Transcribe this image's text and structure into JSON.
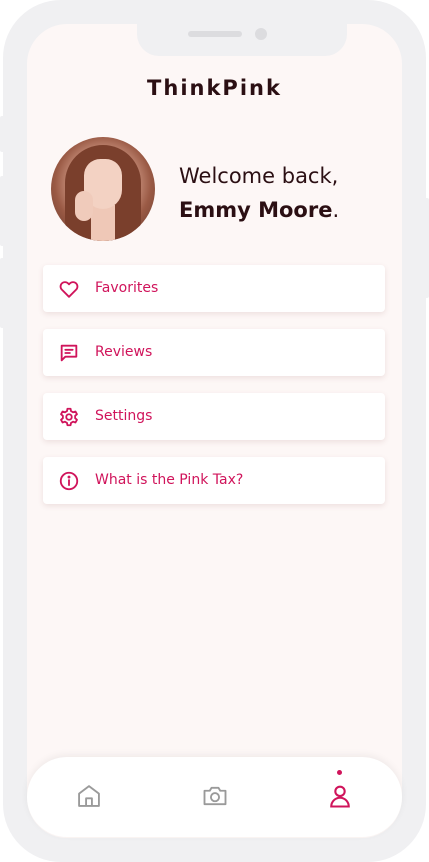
{
  "app": {
    "title": "ThinkPink"
  },
  "profile": {
    "greeting": "Welcome back,",
    "name": "Emmy Moore",
    "name_suffix": "."
  },
  "menu": [
    {
      "label": "Favorites",
      "icon": "heart-icon"
    },
    {
      "label": "Reviews",
      "icon": "chat-icon"
    },
    {
      "label": "Settings",
      "icon": "gear-icon"
    },
    {
      "label": "What is the Pink Tax?",
      "icon": "info-icon"
    }
  ],
  "bottom_nav": [
    {
      "icon": "home-icon",
      "active": false
    },
    {
      "icon": "camera-icon",
      "active": false
    },
    {
      "icon": "profile-icon",
      "active": true
    }
  ],
  "colors": {
    "accent": "#d0145b",
    "background": "#fdf7f6",
    "text": "#2b0f13",
    "inactive": "#9a9a9a"
  }
}
